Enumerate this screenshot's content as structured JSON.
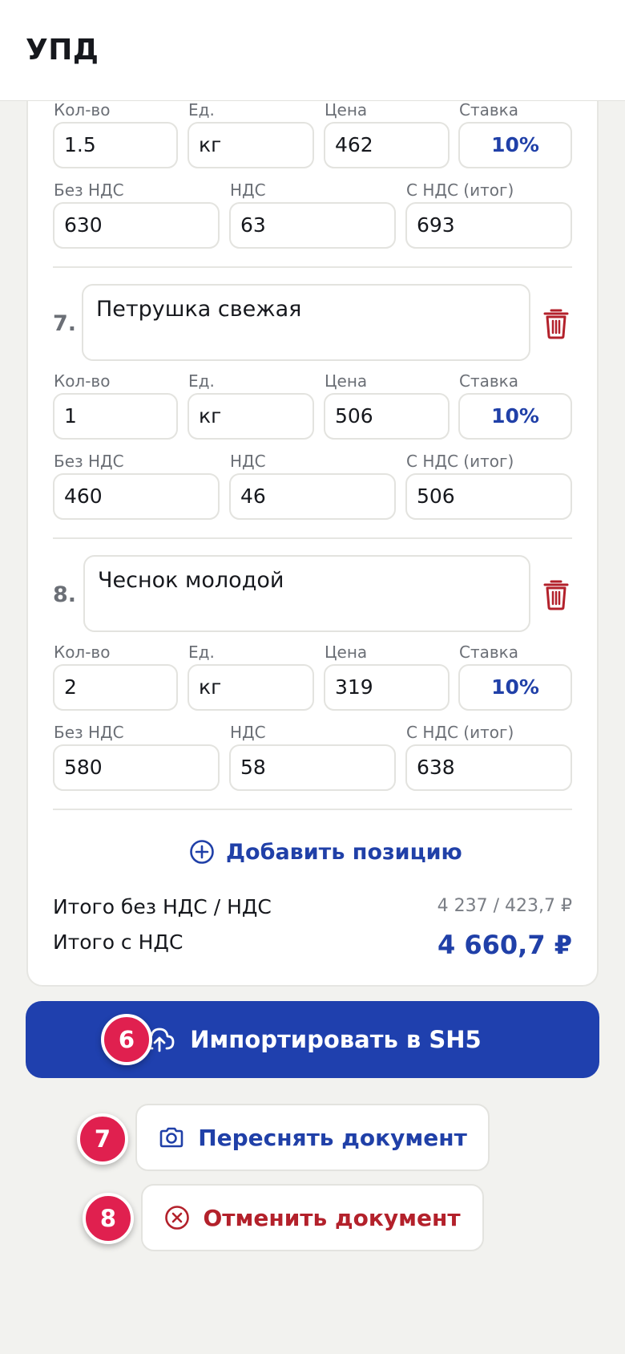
{
  "header": {
    "title": "УПД"
  },
  "labels": {
    "qty": "Кол-во",
    "unit": "Ед.",
    "price": "Цена",
    "rate": "Ставка",
    "net": "Без НДС",
    "vat": "НДС",
    "gross": "С НДС (итог)"
  },
  "items": [
    {
      "qty": "1.5",
      "unit": "кг",
      "price": "462",
      "rate": "10%",
      "net": "630",
      "vat": "63",
      "gross": "693"
    },
    {
      "number": "7.",
      "name": "Петрушка свежая",
      "qty": "1",
      "unit": "кг",
      "price": "506",
      "rate": "10%",
      "net": "460",
      "vat": "46",
      "gross": "506"
    },
    {
      "number": "8.",
      "name": "Чеснок молодой",
      "qty": "2",
      "unit": "кг",
      "price": "319",
      "rate": "10%",
      "net": "580",
      "vat": "58",
      "gross": "638"
    }
  ],
  "add_position": {
    "label": "Добавить позицию",
    "icon": "plus-circle-icon"
  },
  "totals": {
    "net_vat_label": "Итого без НДС / НДС",
    "net_vat_value": "4 237 / 423,7 ₽",
    "gross_label": "Итого с НДС",
    "gross_value": "4 660,7 ₽"
  },
  "actions": {
    "import": {
      "label": "Импортировать в SH5",
      "icon": "cloud-upload-icon",
      "badge": "6"
    },
    "retake": {
      "label": "Переснять документ",
      "icon": "camera-icon",
      "badge": "7"
    },
    "cancel": {
      "label": "Отменить документ",
      "icon": "close-circle-icon",
      "badge": "8"
    }
  },
  "colors": {
    "accent": "#1f40ae",
    "accent_text": "#2040a8",
    "danger": "#b3212b",
    "badge": "#e0204f",
    "background": "#f2f2ef"
  }
}
